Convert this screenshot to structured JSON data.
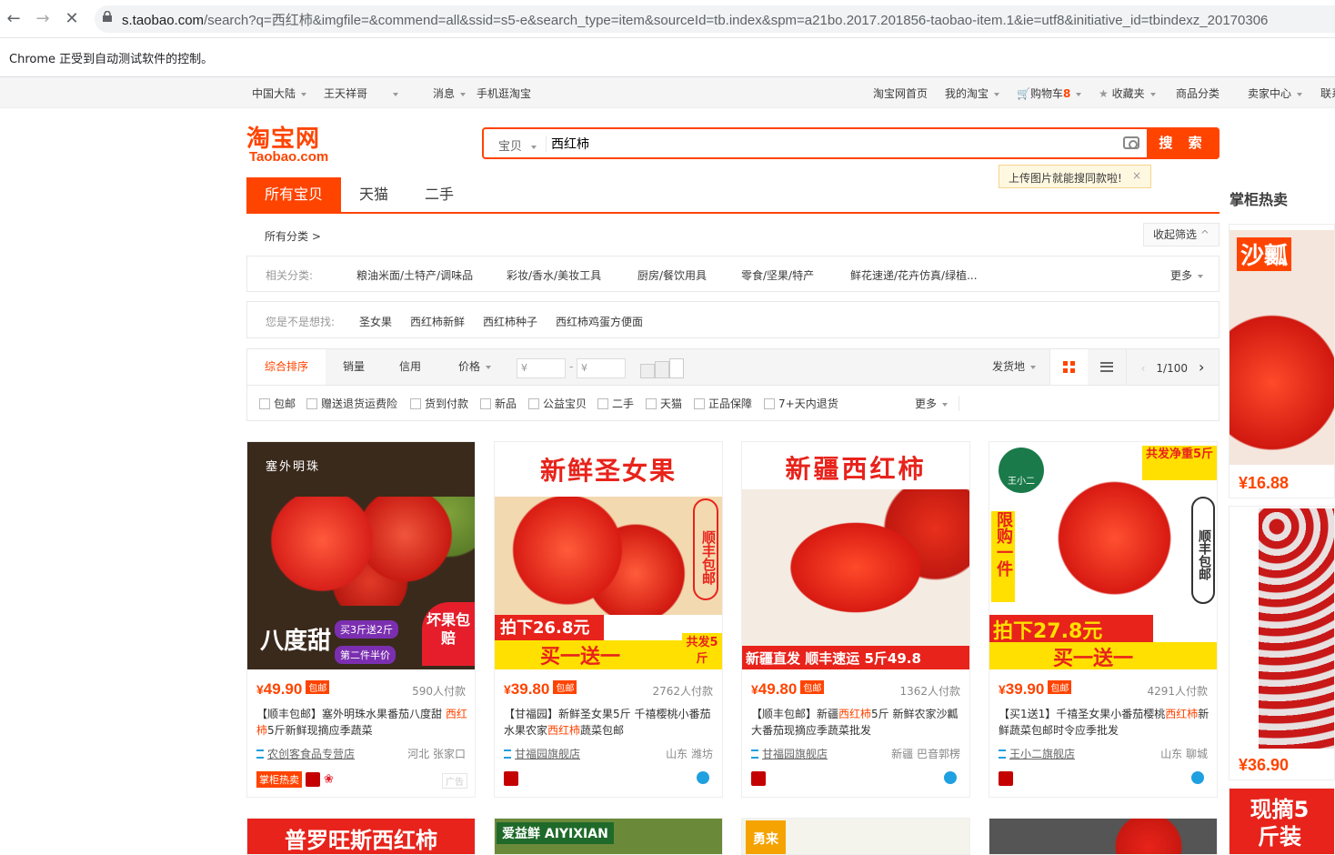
{
  "browser": {
    "url_host": "s.taobao.com",
    "url_query": "/search?q=西红柿&imgfile=&commend=all&ssid=s5-e&search_type=item&sourceId=tb.index&spm=a21bo.2017.201856-taobao-item.1&ie=utf8&initiative_id=tbindexz_20170306",
    "infobar": "Chrome 正受到自动测试软件的控制。"
  },
  "sitenav": {
    "region": "中国大陆",
    "user": "王天祥哥",
    "messages": "消息",
    "mobile": "手机逛淘宝",
    "home": "淘宝网首页",
    "my": "我的淘宝",
    "cart": "购物车",
    "cart_count": "8",
    "fav": "收藏夹",
    "cats": "商品分类",
    "seller": "卖家中心",
    "contact": "联系"
  },
  "logo": {
    "cn": "淘宝网",
    "en": "Taobao.com"
  },
  "search": {
    "category": "宝贝",
    "query": "西红柿",
    "button": "搜 索",
    "tip": "上传图片就能搜同款啦!",
    "tip_close": "×"
  },
  "tabs": [
    "所有宝贝",
    "天猫",
    "二手"
  ],
  "breadcrumb": "所有分类 >",
  "fold": "收起筛选",
  "related": {
    "label": "相关分类:",
    "items": [
      "粮油米面/土特产/调味品",
      "彩妆/香水/美妆工具",
      "厨房/餐饮用具",
      "零食/坚果/特产",
      "鲜花速递/花卉仿真/绿植..."
    ],
    "more": "更多"
  },
  "suggest": {
    "label": "您是不是想找:",
    "items": [
      "圣女果",
      "西红柿新鲜",
      "西红柿种子",
      "西红柿鸡蛋方便面"
    ]
  },
  "sort": {
    "items": [
      "综合排序",
      "销量",
      "信用",
      "价格"
    ],
    "price_from": "¥",
    "price_to": "¥",
    "ship": "发货地",
    "page": "1/100"
  },
  "filters": {
    "items": [
      "包邮",
      "赠送退货运费险",
      "货到付款",
      "新品",
      "公益宝贝",
      "二手",
      "天猫",
      "正品保障",
      "7+天内退货"
    ],
    "more": "更多"
  },
  "products": [
    {
      "price_sym": "¥",
      "price": "49.90",
      "bao": "包邮",
      "deals": "590人付款",
      "title_a": "【顺丰包邮】塞外明珠水果番茄八度甜 ",
      "title_hl": "西红柿",
      "title_b": "5斤新鲜现摘应季蔬菜",
      "shop": "农创客食品专营店",
      "loc": "河北 张家口",
      "badge": "掌柜热卖",
      "ad": "广告",
      "img_text": "塞外明珠",
      "img_sub": "坏果包赔",
      "img_promo": "买3斤送2斤",
      "img_promo2": "第二件半价",
      "img_big": "八度甜"
    },
    {
      "price_sym": "¥",
      "price": "39.80",
      "bao": "包邮",
      "deals": "2762人付款",
      "title_a": "【甘福园】新鲜圣女果5斤 千禧樱桃小番茄水果农家",
      "title_hl": "西红柿",
      "title_b": "蔬菜包邮",
      "shop": "甘福园旗舰店",
      "loc": "山东 潍坊",
      "img_text": "新鲜圣女果",
      "img_sub": "顺丰包邮",
      "img_price": "拍下26.8元",
      "img_promo": "买一送一",
      "img_ship": "共发5斤"
    },
    {
      "price_sym": "¥",
      "price": "49.80",
      "bao": "包邮",
      "deals": "1362人付款",
      "title_a": "【顺丰包邮】新疆",
      "title_hl": "西红柿",
      "title_b": "5斤 新鲜农家沙瓤大番茄现摘应季蔬菜批发",
      "shop": "甘福园旗舰店",
      "loc": "新疆 巴音郭楞",
      "img_text": "新疆西红柿",
      "img_sub": "新疆直发 顺丰速运 5斤49.8"
    },
    {
      "price_sym": "¥",
      "price": "39.90",
      "bao": "包邮",
      "deals": "4291人付款",
      "title_a": "【买1送1】千禧圣女果小番茄樱桃",
      "title_hl": "西红柿",
      "title_b": "新鲜蔬菜包邮时令应季批发",
      "shop": "王小二旗舰店",
      "loc": "山东 聊城",
      "img_text": "共发净重5斤",
      "img_sub": "顺丰包邮",
      "img_side": "限购一件",
      "img_price": "拍下27.8元",
      "img_promo": "买一送一",
      "img_brand": "王小二"
    }
  ],
  "bottom_images": [
    "普罗旺斯西红柿",
    "爱益鲜 AIYIXIAN",
    "勇来",
    ""
  ],
  "side": {
    "title": "掌柜热卖",
    "items": [
      {
        "price": "¥16.88",
        "img_text": "沙瓤"
      },
      {
        "price": "¥36.90",
        "img_text": ""
      },
      {
        "price": "",
        "img_text": "现摘5斤装"
      }
    ]
  },
  "colors": {
    "accent": "#ff4400",
    "tmall": "#c40000",
    "tomato": "#e8231b"
  }
}
